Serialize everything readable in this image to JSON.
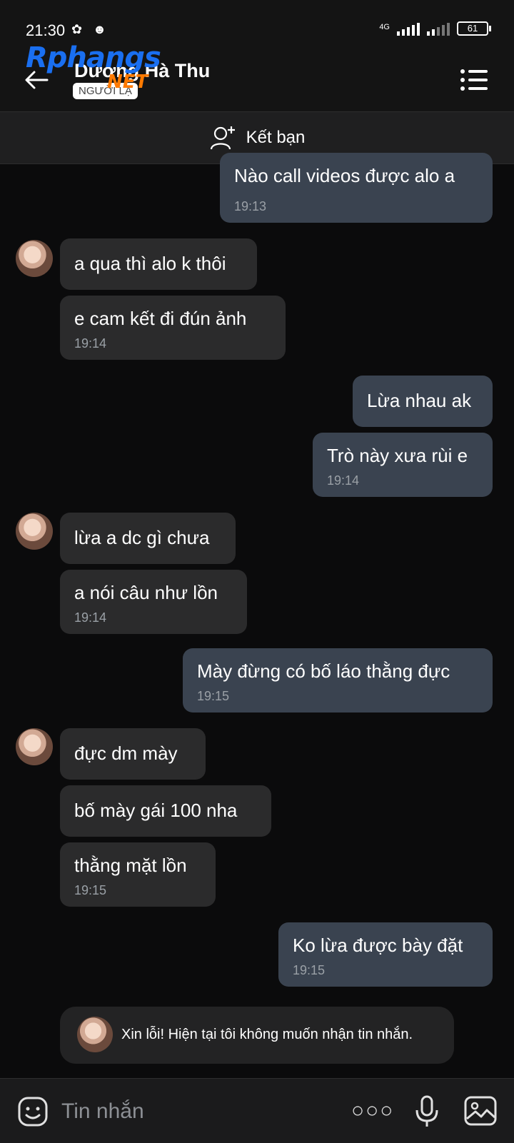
{
  "status_bar": {
    "time": "21:30",
    "network": "4G",
    "battery": "61"
  },
  "header": {
    "contact_name": "Dương Hà Thu",
    "badge": "NGƯỜI LẠ",
    "watermark_logo": "Rphangs",
    "watermark_net": "NET"
  },
  "add_friend": {
    "label": "Kết bạn"
  },
  "messages": [
    {
      "side": "sent",
      "text": "Nào call videos được alo a",
      "time": "19:13"
    },
    {
      "side": "recv",
      "text": "a qua thì alo k thôi",
      "time": ""
    },
    {
      "side": "recv",
      "text": "e  cam kết đi đún ảnh",
      "time": "19:14"
    },
    {
      "side": "sent",
      "text": "Lừa nhau ak",
      "time": ""
    },
    {
      "side": "sent",
      "text": "Trò này xưa rùi e",
      "time": "19:14"
    },
    {
      "side": "recv",
      "text": "lừa a dc gì chưa",
      "time": ""
    },
    {
      "side": "recv",
      "text": "a nói câu như lồn",
      "time": "19:14"
    },
    {
      "side": "sent",
      "text": "Mày đừng có bố láo thằng đực",
      "time": "19:15"
    },
    {
      "side": "recv",
      "text": "đực dm mày",
      "time": ""
    },
    {
      "side": "recv",
      "text": "bố mày gái 100 nha",
      "time": ""
    },
    {
      "side": "recv",
      "text": "thằng mặt lồn",
      "time": "19:15"
    },
    {
      "side": "sent",
      "text": "Ko lừa được bày đặt",
      "time": "19:15"
    }
  ],
  "system_notice": {
    "text": "Xin lỗi! Hiện tại tôi không muốn nhận tin nhắn."
  },
  "composer": {
    "placeholder": "Tin nhắn"
  },
  "colors": {
    "background": "#0b0b0c",
    "sent_bubble": "#3a4350",
    "received_bubble": "#2b2b2c"
  }
}
